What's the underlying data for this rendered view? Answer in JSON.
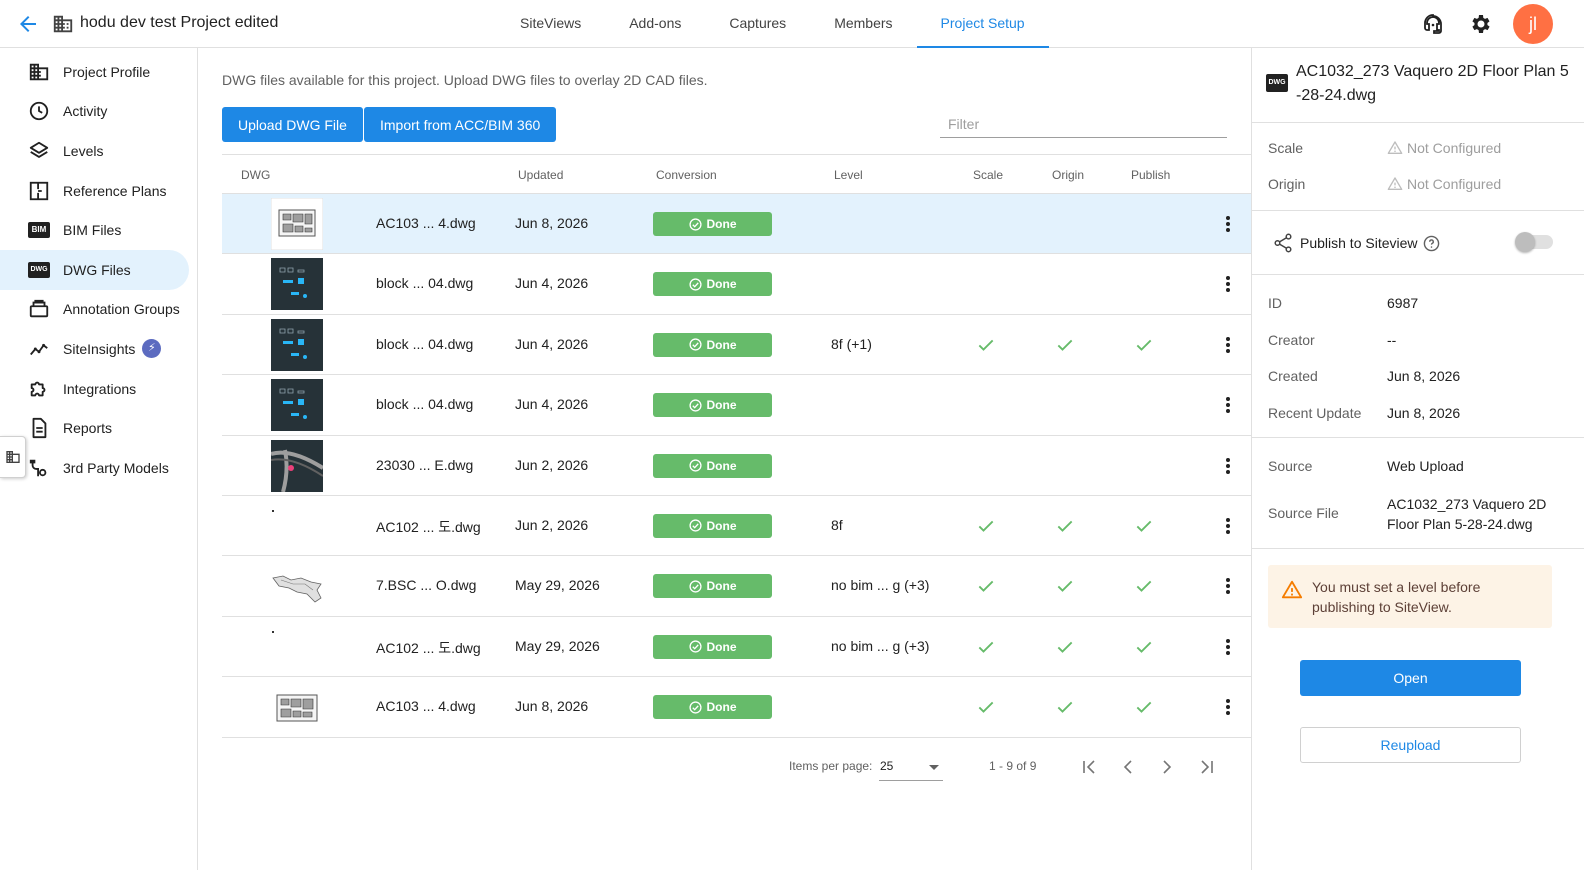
{
  "header": {
    "project_title": "hodu dev test Project edited",
    "tabs": [
      {
        "label": "SiteViews"
      },
      {
        "label": "Add-ons"
      },
      {
        "label": "Captures"
      },
      {
        "label": "Members"
      },
      {
        "label": "Project Setup",
        "active": true
      }
    ],
    "avatar_initials": "jl",
    "avatar_color": "#ff7043",
    "accent_color": "#1e88e5",
    "icons": [
      "back-arrow-icon",
      "building-icon",
      "support-headset-icon",
      "gear-icon"
    ]
  },
  "sidebar": {
    "items": [
      {
        "label": "Project Profile",
        "icon": "building-icon"
      },
      {
        "label": "Activity",
        "icon": "clock-icon"
      },
      {
        "label": "Levels",
        "icon": "layers-icon"
      },
      {
        "label": "Reference Plans",
        "icon": "floorplan-icon"
      },
      {
        "label": "BIM Files",
        "icon": "bim-icon",
        "icon_text": "BIM"
      },
      {
        "label": "DWG Files",
        "icon": "dwg-icon",
        "icon_text": "DWG",
        "active": true
      },
      {
        "label": "Annotation Groups",
        "icon": "annotation-icon"
      },
      {
        "label": "SiteInsights",
        "icon": "trend-icon",
        "badge": "lightning-icon"
      },
      {
        "label": "Integrations",
        "icon": "puzzle-icon"
      },
      {
        "label": "Reports",
        "icon": "document-icon"
      },
      {
        "label": "3rd Party Models",
        "icon": "plug-icon"
      }
    ]
  },
  "main": {
    "description": "DWG files available for this project. Upload DWG files to overlay 2D CAD files.",
    "upload_label": "Upload DWG File",
    "import_label": "Import from ACC/BIM 360",
    "filter_placeholder": "Filter",
    "columns": {
      "dwg": "DWG",
      "updated": "Updated",
      "conversion": "Conversion",
      "level": "Level",
      "scale": "Scale",
      "origin": "Origin",
      "publish": "Publish"
    },
    "status_color": "#66bb6a",
    "rows": [
      {
        "name": "AC103 ... 4.dwg",
        "updated": "Jun 8, 2026",
        "conversion": "Done",
        "level": "",
        "scale": false,
        "origin": false,
        "publish": false,
        "thumb": "light-plan",
        "selected": true
      },
      {
        "name": "block ... 04.dwg",
        "updated": "Jun 4, 2026",
        "conversion": "Done",
        "level": "",
        "scale": false,
        "origin": false,
        "publish": false,
        "thumb": "dark-block"
      },
      {
        "name": "block ... 04.dwg",
        "updated": "Jun 4, 2026",
        "conversion": "Done",
        "level": "8f (+1)",
        "scale": true,
        "origin": true,
        "publish": true,
        "thumb": "dark-block"
      },
      {
        "name": "block ... 04.dwg",
        "updated": "Jun 4, 2026",
        "conversion": "Done",
        "level": "",
        "scale": false,
        "origin": false,
        "publish": false,
        "thumb": "dark-block"
      },
      {
        "name": "23030 ... E.dwg",
        "updated": "Jun 2, 2026",
        "conversion": "Done",
        "level": "",
        "scale": false,
        "origin": false,
        "publish": false,
        "thumb": "dark-road"
      },
      {
        "name": "AC102 ... 도.dwg",
        "updated": "Jun 2, 2026",
        "conversion": "Done",
        "level": "8f",
        "scale": true,
        "origin": true,
        "publish": true,
        "thumb": "dot"
      },
      {
        "name": "7.BSC ... O.dwg",
        "updated": "May 29, 2026",
        "conversion": "Done",
        "level": "no bim ... g (+3)",
        "scale": true,
        "origin": true,
        "publish": true,
        "thumb": "map"
      },
      {
        "name": "AC102 ... 도.dwg",
        "updated": "May 29, 2026",
        "conversion": "Done",
        "level": "no bim ... g (+3)",
        "scale": true,
        "origin": true,
        "publish": true,
        "thumb": "dot"
      },
      {
        "name": "AC103 ... 4.dwg",
        "updated": "Jun 8, 2026",
        "conversion": "Done",
        "level": "",
        "scale": true,
        "origin": true,
        "publish": true,
        "thumb": "light-plan-small"
      }
    ],
    "pagination": {
      "items_per_page_label": "Items per page:",
      "items_per_page": "25",
      "range": "1 - 9 of 9"
    }
  },
  "detail": {
    "file_icon_text": "DWG",
    "title": "AC1032_273 Vaquero 2D Floor Plan 5-28-24.dwg",
    "scale_label": "Scale",
    "scale_value": "Not Configured",
    "origin_label": "Origin",
    "origin_value": "Not Configured",
    "publish_label": "Publish to Siteview",
    "publish_enabled": false,
    "id_label": "ID",
    "id_value": "6987",
    "creator_label": "Creator",
    "creator_value": "--",
    "created_label": "Created",
    "created_value": "Jun 8, 2026",
    "recent_update_label": "Recent Update",
    "recent_update_value": "Jun 8, 2026",
    "source_label": "Source",
    "source_value": "Web Upload",
    "source_file_label": "Source File",
    "source_file_value": "AC1032_273 Vaquero 2D Floor Plan 5-28-24.dwg",
    "warning": "You must set a level before publishing to SiteView.",
    "open_label": "Open",
    "reupload_label": "Reupload"
  }
}
